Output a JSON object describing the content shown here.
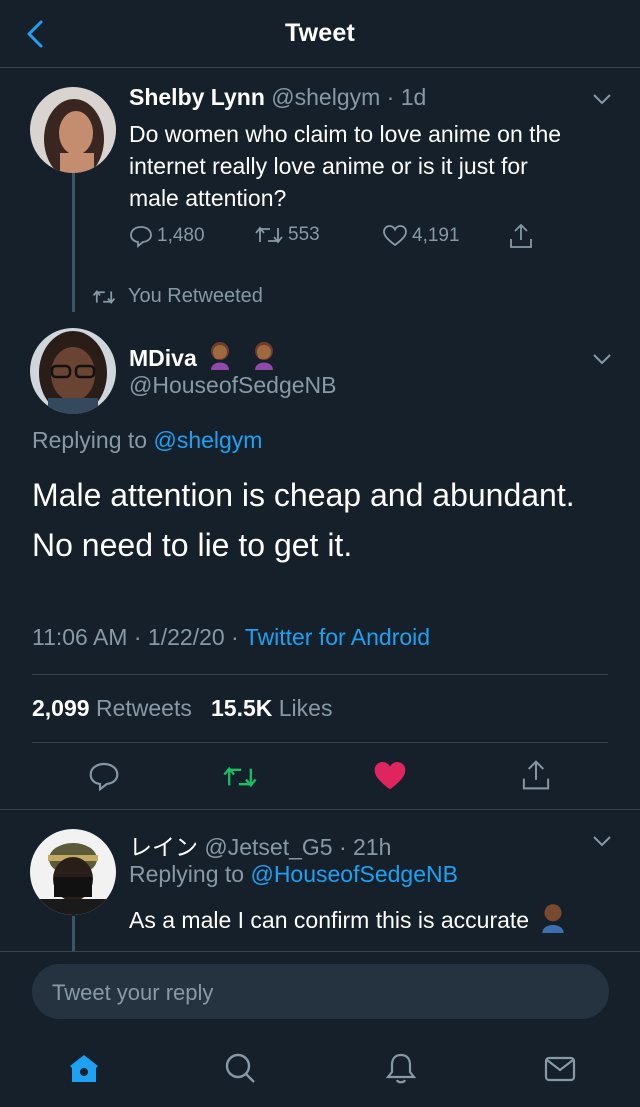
{
  "header": {
    "title": "Tweet"
  },
  "parent_tweet": {
    "name": "Shelby Lynn",
    "handle": "@shelgym",
    "time": "· 1d",
    "text_lines": [
      "Do women who claim to love anime on the",
      "internet really love anime or is it just for",
      "male attention?"
    ],
    "replies": "1,480",
    "retweets": "553",
    "likes": "4,191"
  },
  "retweeted_label": "You Retweeted",
  "main_tweet": {
    "name": "MDiva",
    "handle": "@HouseofSedgeNB",
    "replying_prefix": "Replying to",
    "replying_to": "@shelgym",
    "text_lines": [
      "Male attention is cheap and abundant.",
      "No need to lie to get it."
    ],
    "time": "11:06 AM",
    "date": "· 1/22/20 ·",
    "source": "Twitter for Android",
    "retweet_count": "2,099",
    "retweet_label": "Retweets",
    "like_count": "15.5K",
    "like_label": "Likes"
  },
  "reply_tweet": {
    "name": "レイン",
    "handle": "@Jetset_G5",
    "time": "· 21h",
    "replying_prefix": "Replying to",
    "replying_to": "@HouseofSedgeNB",
    "text": "As a male I can confirm this is accurate"
  },
  "compose": {
    "placeholder": "Tweet your reply"
  },
  "colors": {
    "background": "#15202b",
    "accent": "#1da1f2",
    "muted": "#8899a6",
    "retweet_active": "#17bf63",
    "like_active": "#e0245e"
  }
}
